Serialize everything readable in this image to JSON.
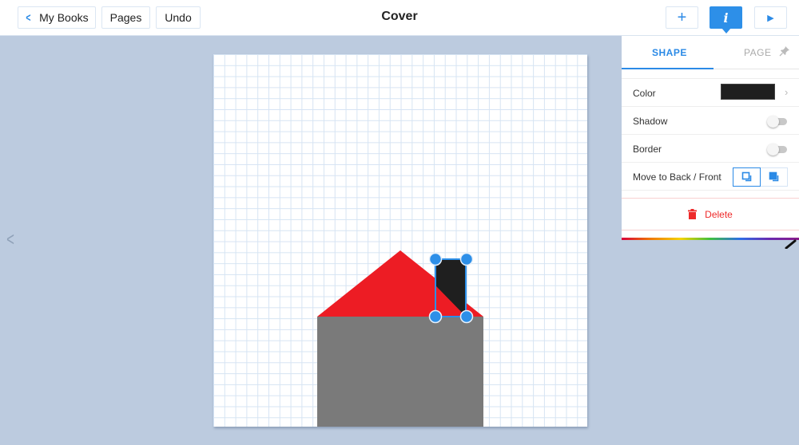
{
  "header": {
    "back_label": "My Books",
    "pages_label": "Pages",
    "undo_label": "Undo",
    "title": "Cover",
    "add_icon": "plus-icon",
    "info_icon": "info-icon",
    "play_icon": "play-icon",
    "add_glyph": "+",
    "info_glyph": "i",
    "play_glyph": "▶",
    "back_glyph": "<"
  },
  "navigation": {
    "prev_page_glyph": "<"
  },
  "canvas": {
    "grid_color": "#d6e4f3",
    "shapes": [
      {
        "type": "triangle",
        "name": "roof",
        "color": "#ed1c24"
      },
      {
        "type": "rectangle",
        "name": "house-body",
        "color": "#7a7a7a"
      },
      {
        "type": "rectangle",
        "name": "chimney",
        "color": "#1f1f1f",
        "selected": true
      }
    ],
    "selection_color": "#2d8fe8"
  },
  "panel": {
    "tabs": [
      {
        "label": "SHAPE",
        "active": true
      },
      {
        "label": "PAGE",
        "active": false
      }
    ],
    "color_label": "Color",
    "color_value": "#1f1f1f",
    "shadow_label": "Shadow",
    "shadow_on": false,
    "border_label": "Border",
    "border_on": false,
    "order_label": "Move to Back / Front",
    "delete_label": "Delete",
    "chevron_glyph": "›"
  },
  "colors": {
    "accent": "#2b8ae6",
    "danger": "#ee2a2a",
    "workspace_bg": "#bccbdf"
  }
}
